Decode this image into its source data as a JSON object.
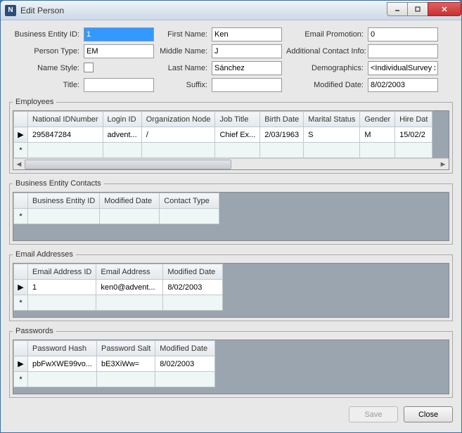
{
  "window": {
    "title": "Edit Person"
  },
  "form": {
    "labels": {
      "beid": "Business Entity ID:",
      "ptype": "Person Type:",
      "nstyle": "Name Style:",
      "title": "Title:",
      "fname": "First Name:",
      "mname": "Middle Name:",
      "lname": "Last Name:",
      "suffix": "Suffix:",
      "epromo": "Email Promotion:",
      "aci": "Additional Contact Info:",
      "demo": "Demographics:",
      "mdate": "Modified Date:"
    },
    "values": {
      "beid": "1",
      "ptype": "EM",
      "title": "",
      "fname": "Ken",
      "mname": "J",
      "lname": "Sánchez",
      "suffix": "",
      "epromo": "0",
      "aci": "",
      "demo": "<IndividualSurvey xn",
      "mdate": "8/02/2003"
    }
  },
  "sections": {
    "employees": "Employees",
    "bec": "Business Entity Contacts",
    "emails": "Email Addresses",
    "passwords": "Passwords"
  },
  "employees": {
    "cols": [
      "National IDNumber",
      "Login ID",
      "Organization Node",
      "Job Title",
      "Birth Date",
      "Marital Status",
      "Gender",
      "Hire Dat"
    ],
    "row": [
      "295847284",
      "advent...",
      "/",
      "Chief Ex...",
      "2/03/1963",
      "S",
      "M",
      "15/02/2"
    ]
  },
  "bec": {
    "cols": [
      "Business Entity ID",
      "Modified Date",
      "Contact Type"
    ]
  },
  "emails": {
    "cols": [
      "Email Address ID",
      "Email Address",
      "Modified Date"
    ],
    "row": [
      "1",
      "ken0@advent...",
      "8/02/2003"
    ]
  },
  "passwords": {
    "cols": [
      "Password Hash",
      "Password Salt",
      "Modified Date"
    ],
    "row": [
      "pbFwXWE99vo...",
      "bE3XiWw=",
      "8/02/2003"
    ]
  },
  "buttons": {
    "save": "Save",
    "close": "Close"
  },
  "glyphs": {
    "row_arrow": "▶",
    "new_row": "*",
    "scroll_left": "◄",
    "scroll_right": "►"
  }
}
